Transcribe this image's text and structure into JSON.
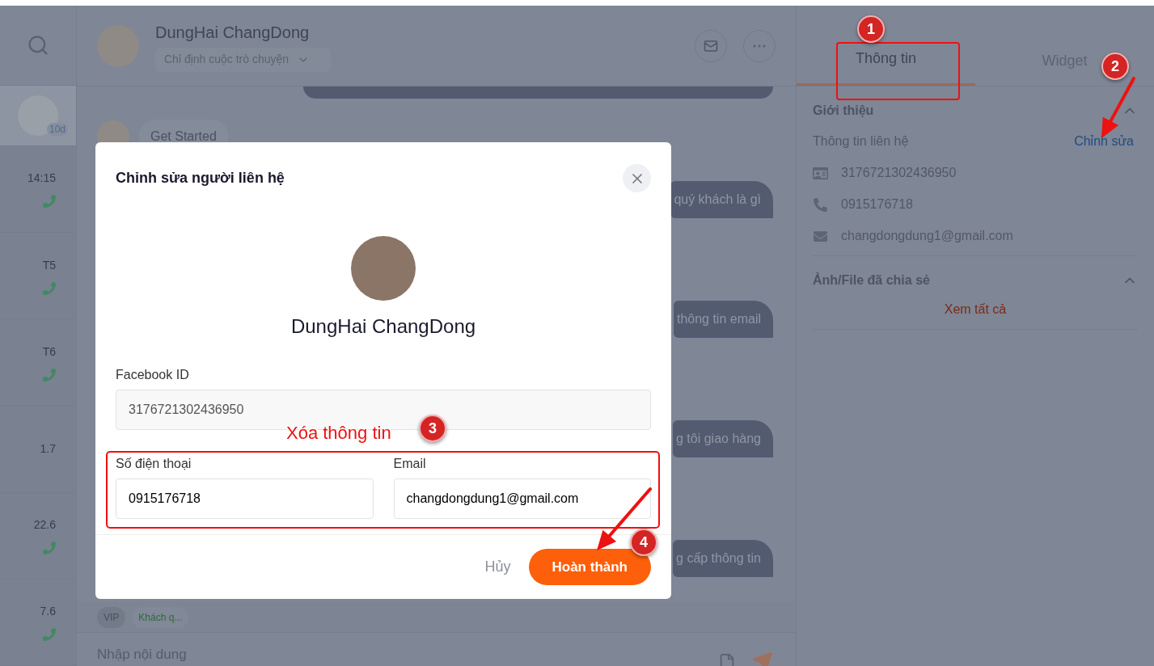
{
  "sidebar": {
    "conversations": [
      {
        "kind": "avatar",
        "badge": "10d",
        "selected": true
      },
      {
        "kind": "time",
        "time": "14:15",
        "call": true,
        "selected": false
      },
      {
        "kind": "time",
        "time": "T5",
        "call": true,
        "selected": false
      },
      {
        "kind": "time",
        "time": "T6",
        "call": true,
        "selected": false
      },
      {
        "kind": "time",
        "time": "1.7",
        "call": false,
        "selected": false
      },
      {
        "kind": "time",
        "time": "22.6",
        "call": true,
        "selected": false
      },
      {
        "kind": "time",
        "time": "7.6",
        "call": true,
        "selected": false
      }
    ]
  },
  "chat": {
    "name": "DungHai ChangDong",
    "assign_placeholder": "Chỉ định cuộc trò chuyện",
    "messages": [
      {
        "kind": "incoming",
        "text": "Get Started"
      },
      {
        "kind": "outgoing",
        "text": "quý khách là gì"
      },
      {
        "kind": "outgoing",
        "text": "thông tin email"
      },
      {
        "kind": "outgoing",
        "text": "g tôi giao hàng"
      },
      {
        "kind": "outgoing",
        "text": "g cấp thông tin"
      }
    ],
    "tags": [
      {
        "text": "VIP",
        "kind": "gray"
      },
      {
        "text": "Khách q...",
        "kind": "green"
      }
    ],
    "composer_placeholder": "Nhập nội dung"
  },
  "info_panel": {
    "tabs": [
      {
        "label": "Thông tin",
        "selected": true
      },
      {
        "label": "Widget",
        "selected": false
      }
    ],
    "sections": [
      {
        "kind": "contact",
        "title": "Giới thiệu",
        "expanded": true,
        "subtitle": "Thông tin liên hệ",
        "edit_link": "Chỉnh sửa",
        "items": [
          {
            "kind": "id",
            "text": "3176721302436950"
          },
          {
            "kind": "phone",
            "text": "0915176718"
          },
          {
            "kind": "email",
            "text": "changdongdung1@gmail.com"
          }
        ]
      },
      {
        "kind": "files",
        "title": "Ảnh/File đã chia sẻ",
        "expanded": true,
        "link": "Xem tất cả"
      }
    ]
  },
  "modal": {
    "title": "Chỉnh sửa người liên hệ",
    "name": "DungHai ChangDong",
    "fields": [
      {
        "label": "Facebook ID",
        "value": "3176721302436950",
        "disabled": true
      },
      {
        "label": "Số điện thoại",
        "value": "0915176718",
        "disabled": false
      },
      {
        "label": "Email",
        "value": "changdongdung1@gmail.com",
        "disabled": false
      }
    ],
    "cancel": "Hủy",
    "submit": "Hoàn thành"
  },
  "annotations": {
    "steps": [
      "1",
      "2",
      "3",
      "4"
    ],
    "note": "Xóa thông tin"
  }
}
